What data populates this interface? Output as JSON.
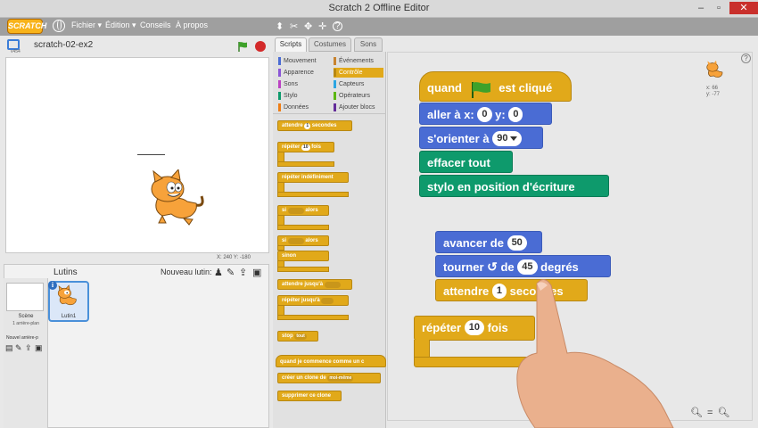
{
  "window": {
    "title": "Scratch 2 Offline Editor"
  },
  "menu": {
    "logo": "SCRATCH",
    "items": [
      "Fichier ▾",
      "Édition ▾",
      "Conseils",
      "À propos"
    ]
  },
  "stage": {
    "version": "v454",
    "project_title": "scratch-02-ex2",
    "coords": "X: 240  Y: -180"
  },
  "sprites_pane": {
    "lutins_label": "Lutins",
    "new_sprite_label": "Nouveau lutin:",
    "scene_label": "Scène",
    "scene_count": "1 arrière-plan",
    "new_backdrop_label": "Nouvel arrière-p",
    "sprite_name": "Lutin1"
  },
  "tabs": [
    "Scripts",
    "Costumes",
    "Sons"
  ],
  "categories": [
    {
      "label": "Mouvement",
      "color": "#4a6cd4"
    },
    {
      "label": "Événements",
      "color": "#c88330"
    },
    {
      "label": "Apparence",
      "color": "#8a55d7"
    },
    {
      "label": "Contrôle",
      "color": "#e1a91a"
    },
    {
      "label": "Sons",
      "color": "#bb42c3"
    },
    {
      "label": "Capteurs",
      "color": "#2ca5e2"
    },
    {
      "label": "Stylo",
      "color": "#0e9a6c"
    },
    {
      "label": "Opérateurs",
      "color": "#5cb712"
    },
    {
      "label": "Données",
      "color": "#ee7d16"
    },
    {
      "label": "Ajouter blocs",
      "color": "#632d99"
    }
  ],
  "palette": {
    "attendre_a": "attendre",
    "attendre_num": "1",
    "attendre_b": "secondes",
    "repeter_a": "répéter",
    "repeter_num": "10",
    "repeter_b": "fois",
    "repeter_indef": "répéter indéfiniment",
    "si_alors": "si",
    "alors": "alors",
    "si2": "si",
    "alors2": "alors",
    "sinon": "sinon",
    "attendre_jusqua": "attendre jusqu'à",
    "repeter_jusqua": "répéter jusqu'à",
    "stop": "stop",
    "stop_opt": "tout",
    "clone_start": "quand je commence comme un c",
    "clone_create": "créer un clone de",
    "clone_opt": "moi-même",
    "clone_delete": "supprimer ce clone"
  },
  "script": {
    "hat_a": "quand",
    "hat_b": "est cliqué",
    "goto_a": "aller à x:",
    "goto_x": "0",
    "goto_b": "y:",
    "goto_y": "0",
    "orient": "s'orienter à",
    "orient_val": "90",
    "clear": "effacer tout",
    "pendown": "stylo en position d'écriture",
    "move_a": "avancer de",
    "move_val": "50",
    "turn_a": "tourner",
    "turn_b": "de",
    "turn_val": "45",
    "turn_c": "degrés",
    "wait_a": "attendre",
    "wait_val": "1",
    "wait_b": "secondes",
    "repeat_a": "répéter",
    "repeat_val": "10",
    "repeat_b": "fois"
  },
  "sprite_info": {
    "xy": "x: 66\ny: -77"
  },
  "colors": {
    "control": "#e1a91a",
    "motion": "#4a6cd4",
    "pen": "#0e9a6c",
    "events": "#c88330"
  }
}
